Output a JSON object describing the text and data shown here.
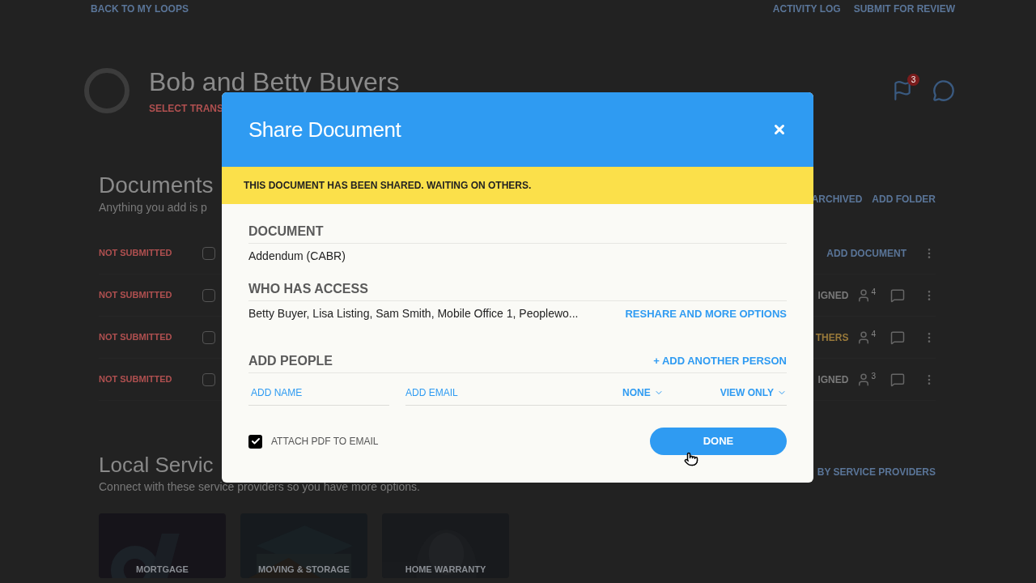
{
  "page": {
    "back_link": "BACK TO MY LOOPS",
    "top_links": [
      "ACTIVITY LOG",
      "SUBMIT FOR REVIEW"
    ],
    "title": "Bob and Betty Buyers",
    "subtitle": "SELECT TRANS",
    "notification_count": "3"
  },
  "documents": {
    "heading": "Documents",
    "description": "Anything you add is p",
    "actions": [
      "ARCHIVED",
      "ADD FOLDER"
    ],
    "rows": [
      {
        "kind": "add",
        "status": "NOT SUBMITTED",
        "checked": false,
        "action": "ADD DOCUMENT"
      },
      {
        "kind": "document",
        "status": "NOT SUBMITTED",
        "checked": false,
        "state": "IGNED",
        "color": "#7a7a7a",
        "shares": "4"
      },
      {
        "kind": "document",
        "status": "NOT SUBMITTED",
        "checked": false,
        "state": "THERS",
        "color": "#9a7a3a",
        "shares": "4"
      },
      {
        "kind": "document",
        "status": "NOT SUBMITTED",
        "checked": false,
        "state": "IGNED",
        "color": "#7a7a7a",
        "shares": "3"
      }
    ]
  },
  "services": {
    "heading": "Local Servic",
    "description": "Connect with these service providers so you have more options.",
    "link": "BY SERVICE PROVIDERS",
    "cards": [
      "MORTGAGE",
      "MOVING & STORAGE",
      "HOME WARRANTY"
    ]
  },
  "dialog": {
    "title": "Share Document",
    "banner": "THIS DOCUMENT HAS BEEN SHARED. WAITING ON OTHERS.",
    "document_label": "DOCUMENT",
    "document_name": "Addendum (CABR)",
    "access_label": "WHO HAS ACCESS",
    "access_list": "Betty Buyer, Lisa Listing, Sam Smith, Mobile Office 1, Peoplewo...",
    "reshare_link": "RESHARE AND MORE OPTIONS",
    "add_label": "ADD PEOPLE",
    "add_another": "+ ADD ANOTHER PERSON",
    "name_placeholder": "ADD NAME",
    "email_placeholder": "ADD EMAIL",
    "dropdowns": [
      "NONE",
      "VIEW ONLY"
    ],
    "attach_pdf": {
      "label": "ATTACH PDF TO EMAIL",
      "checked": true
    },
    "done": "DONE"
  }
}
